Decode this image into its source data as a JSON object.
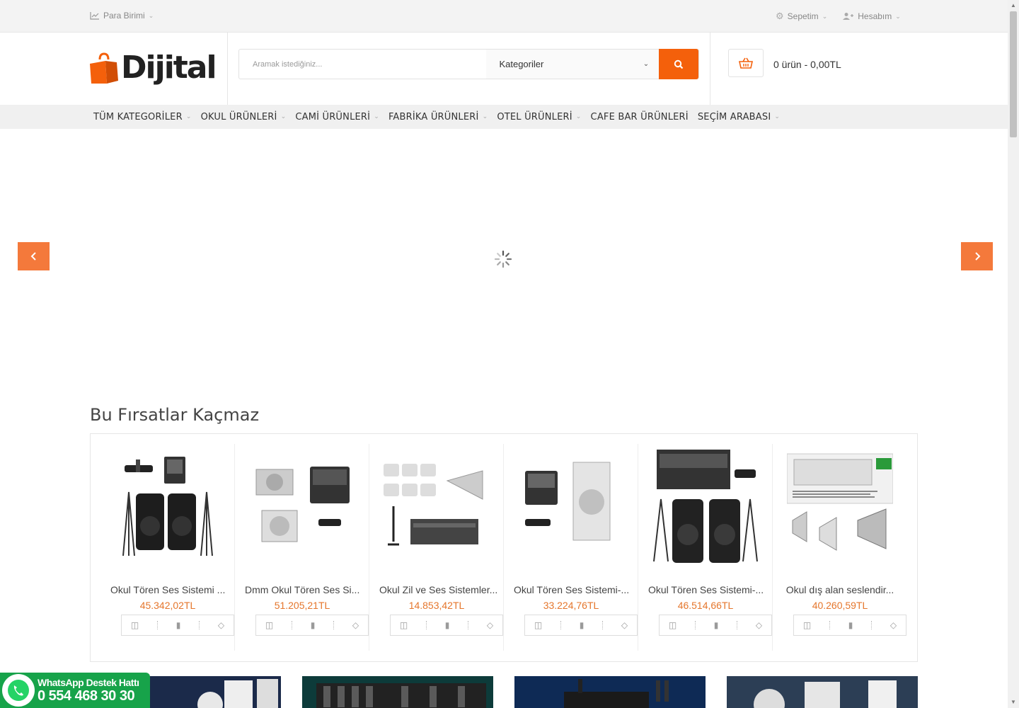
{
  "topbar": {
    "currency_label": "Para Birimi",
    "cart_label": "Sepetim",
    "account_label": "Hesabım"
  },
  "header": {
    "logo_text": "Dijital",
    "search_placeholder": "Aramak istediğiniz...",
    "category_select": "Kategoriler",
    "cart_summary": "0 ürün - 0,00TL"
  },
  "nav": {
    "items": [
      {
        "label": "TÜM KATEGORİLER",
        "has_dropdown": true
      },
      {
        "label": "OKUL ÜRÜNLERİ",
        "has_dropdown": true
      },
      {
        "label": "CAMİ ÜRÜNLERİ",
        "has_dropdown": true
      },
      {
        "label": "FABRİKA ÜRÜNLERİ",
        "has_dropdown": true
      },
      {
        "label": "OTEL ÜRÜNLERİ",
        "has_dropdown": true
      },
      {
        "label": "CAFE BAR ÜRÜNLERİ",
        "has_dropdown": false
      },
      {
        "label": "SEÇİM ARABASI",
        "has_dropdown": true
      }
    ]
  },
  "section": {
    "title": "Bu Fırsatlar Kaçmaz"
  },
  "products": [
    {
      "name": "Okul Tören Ses Sistemi ...",
      "price": "45.342,02TL"
    },
    {
      "name": "Dmm Okul Tören Ses Si...",
      "price": "51.205,21TL"
    },
    {
      "name": "Okul Zil ve Ses Sistemler...",
      "price": "14.853,42TL"
    },
    {
      "name": "Okul Tören Ses Sistemi-...",
      "price": "33.224,76TL"
    },
    {
      "name": "Okul Tören Ses Sistemi-...",
      "price": "46.514,66TL"
    },
    {
      "name": "Okul dış alan seslendir...",
      "price": "40.260,59TL"
    }
  ],
  "whatsapp": {
    "line1": "WhatsApp Destek Hattı",
    "line2": "0 554 468 30 30"
  },
  "colors": {
    "accent": "#f4600b",
    "slider_arrow": "#f4793b",
    "price": "#e5762c",
    "whatsapp": "#17a34a"
  },
  "icons": {
    "currency": "chart-line-icon",
    "cart_top": "gear-icon",
    "account": "users-icon",
    "search": "search-icon",
    "cart": "basket-icon",
    "product_actions": [
      "basket-icon",
      "bar-chart-icon",
      "diamond-icon"
    ]
  }
}
